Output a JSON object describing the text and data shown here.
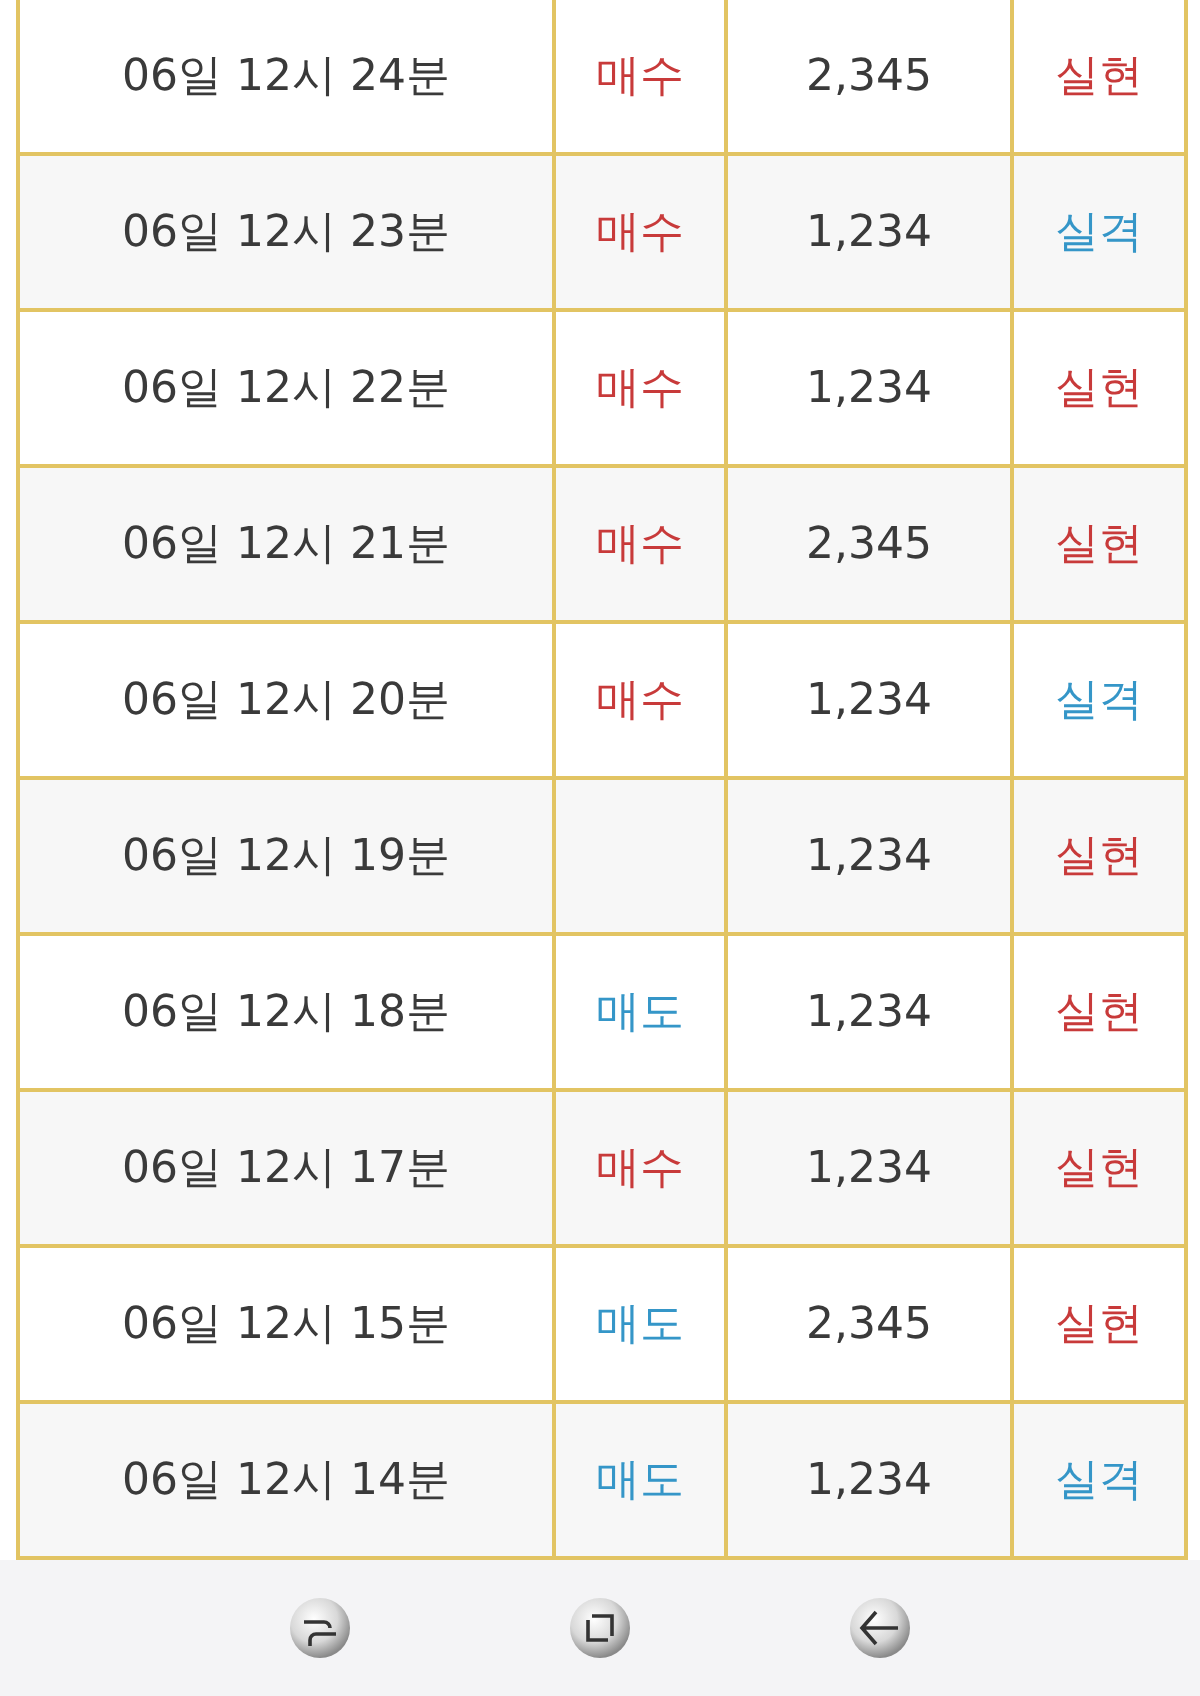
{
  "rows": [
    {
      "time": "06일 12시 24분",
      "type": {
        "text": "매수",
        "color": "#c83a3a"
      },
      "amount": "2,345",
      "result": {
        "text": "실현",
        "color": "#c83a3a"
      }
    },
    {
      "time": "06일 12시 23분",
      "type": {
        "text": "매수",
        "color": "#c83a3a"
      },
      "amount": "1,234",
      "result": {
        "text": "실격",
        "color": "#3596c8"
      }
    },
    {
      "time": "06일 12시 22분",
      "type": {
        "text": "매수",
        "color": "#c83a3a"
      },
      "amount": "1,234",
      "result": {
        "text": "실현",
        "color": "#c83a3a"
      }
    },
    {
      "time": "06일 12시 21분",
      "type": {
        "text": "매수",
        "color": "#c83a3a"
      },
      "amount": "2,345",
      "result": {
        "text": "실현",
        "color": "#c83a3a"
      }
    },
    {
      "time": "06일 12시 20분",
      "type": {
        "text": "매수",
        "color": "#c83a3a"
      },
      "amount": "1,234",
      "result": {
        "text": "실격",
        "color": "#3596c8"
      }
    },
    {
      "time": "06일 12시 19분",
      "amount": "1,234",
      "result": {
        "text": "실현",
        "color": "#c83a3a"
      }
    },
    {
      "time": "06일 12시 18분",
      "type": {
        "text": "매도",
        "color": "#3596c8"
      },
      "amount": "1,234",
      "result": {
        "text": "실현",
        "color": "#c83a3a"
      }
    },
    {
      "time": "06일 12시 17분",
      "type": {
        "text": "매수",
        "color": "#c83a3a"
      },
      "amount": "1,234",
      "result": {
        "text": "실현",
        "color": "#c83a3a"
      }
    },
    {
      "time": "06일 12시 15분",
      "type": {
        "text": "매도",
        "color": "#3596c8"
      },
      "amount": "2,345",
      "result": {
        "text": "실현",
        "color": "#c83a3a"
      }
    },
    {
      "time": "06일 12시 14분",
      "type": {
        "text": "매도",
        "color": "#3596c8"
      },
      "amount": "1,234",
      "result": {
        "text": "실격",
        "color": "#3596c8"
      }
    }
  ]
}
